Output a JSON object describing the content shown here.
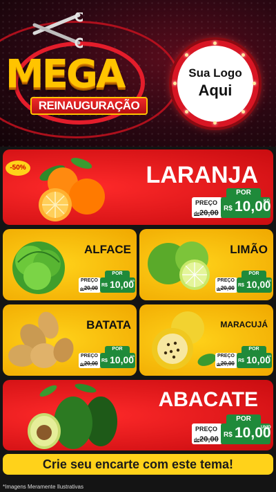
{
  "header": {
    "logo_main": "MEGA",
    "logo_sub": "REINAUGURAÇÃO",
    "store_logo_line1": "Sua Logo",
    "store_logo_line2": "Aqui"
  },
  "discount_badge": "-50%",
  "products": [
    {
      "name": "LARANJA",
      "por": "POR",
      "preco_label": "PREÇO",
      "de": "de",
      "old_price": "20,00",
      "currency": "R$",
      "new_price": "10,00",
      "unit": "KG"
    },
    {
      "name": "ALFACE",
      "por": "POR",
      "preco_label": "PREÇO",
      "de": "de",
      "old_price": "20,00",
      "currency": "R$",
      "new_price": "10,00",
      "unit": "KG"
    },
    {
      "name": "LIMÃO",
      "por": "POR",
      "preco_label": "PREÇO",
      "de": "de",
      "old_price": "20,00",
      "currency": "R$",
      "new_price": "10,00",
      "unit": "KG"
    },
    {
      "name": "BATATA",
      "por": "POR",
      "preco_label": "PREÇO",
      "de": "de",
      "old_price": "20,00",
      "currency": "R$",
      "new_price": "10,00",
      "unit": "KG"
    },
    {
      "name": "MARACUJÁ",
      "por": "POR",
      "preco_label": "PREÇO",
      "de": "de",
      "old_price": "20,00",
      "currency": "R$",
      "new_price": "10,00",
      "unit": "KG"
    },
    {
      "name": "ABACATE",
      "por": "POR",
      "preco_label": "PREÇO",
      "de": "de",
      "old_price": "20,00",
      "currency": "R$",
      "new_price": "10,00",
      "unit": "UNID"
    }
  ],
  "cta": "Crie seu encarte com este tema!",
  "footnote": "*Imagens Meramente Ilustrativas",
  "colors": {
    "red": "#d81624",
    "yellow": "#ffd21a",
    "green": "#1f8a3a",
    "gold": "#ffc400"
  }
}
